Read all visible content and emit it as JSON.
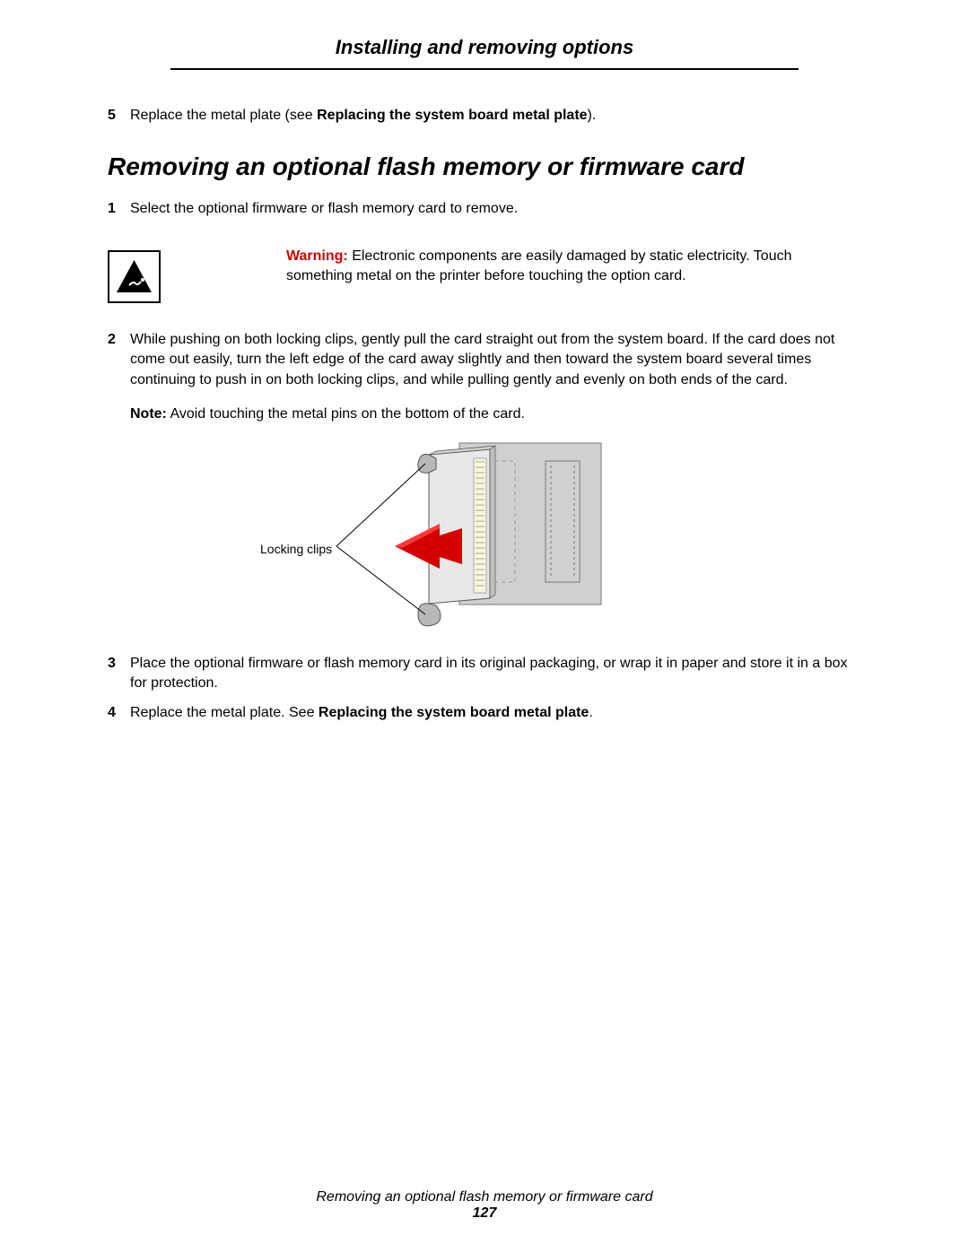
{
  "header": {
    "title": "Installing and removing options"
  },
  "intro_step": {
    "num": "5",
    "text_a": "Replace the metal plate (see ",
    "text_bold": "Replacing the system board metal plate",
    "text_b": ")."
  },
  "section": {
    "title": "Removing an optional flash memory or firmware card"
  },
  "steps": {
    "s1": {
      "num": "1",
      "text": "Select the optional firmware or flash memory card to remove."
    },
    "warning": {
      "label": "Warning:",
      "text": "Electronic components are easily damaged by static electricity. Touch something metal on the printer before touching the option card."
    },
    "s2": {
      "num": "2",
      "text": "While pushing on both locking clips, gently pull the card straight out from the system board. If the card does not come out easily, turn the left edge of the card away slightly and then toward the system board several times continuing to push in on both locking clips, and while pulling gently and evenly on both ends of the card."
    },
    "note": {
      "label": "Note:",
      "text": "Avoid touching the metal pins on the bottom of the card."
    },
    "figure_label": "Locking clips",
    "s3": {
      "num": "3",
      "text": "Place the optional firmware or flash memory card in its original packaging, or wrap it in paper and store it in a box for protection."
    },
    "s4": {
      "num": "4",
      "text_a": "Replace the metal plate. See ",
      "text_bold": "Replacing the system board metal plate",
      "text_b": "."
    }
  },
  "footer": {
    "title": "Removing an optional flash memory or firmware card",
    "page": "127"
  }
}
